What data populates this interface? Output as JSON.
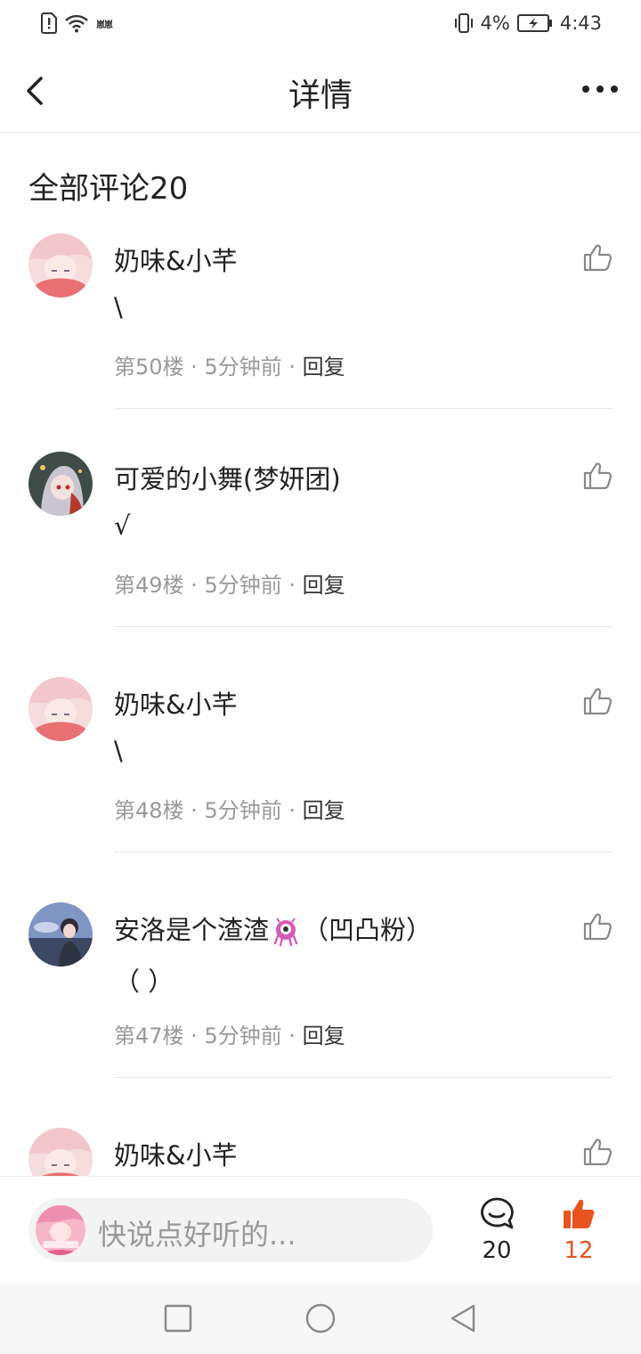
{
  "status_bar": {
    "left_small_text": "崽崽",
    "battery_percent": "4%",
    "time": "4:43",
    "icons": [
      "sim-alert-icon",
      "wifi-icon",
      "vibrate-icon",
      "battery-charging-icon"
    ]
  },
  "header": {
    "title": "详情",
    "back_icon": "back-chevron-icon",
    "more_icon": "more-dots-icon"
  },
  "comments_section": {
    "title": "全部评论20",
    "comments": [
      {
        "name": "奶味&小芊",
        "text": "\\",
        "floor": "第50楼",
        "time": "5分钟前",
        "reply": "回复"
      },
      {
        "name": "可爱的小舞(梦妍团)",
        "text": "√",
        "floor": "第49楼",
        "time": "5分钟前",
        "reply": "回复"
      },
      {
        "name": "奶味&小芊",
        "text": "\\",
        "floor": "第48楼",
        "time": "5分钟前",
        "reply": "回复"
      },
      {
        "name_before": "安洛是个渣渣",
        "name_after": "（凹凸粉）",
        "text": "（ ）",
        "floor": "第47楼",
        "time": "5分钟前",
        "reply": "回复"
      },
      {
        "name": "奶味&小芊"
      }
    ],
    "separator": " · "
  },
  "bottom_bar": {
    "input_placeholder": "快说点好听的...",
    "comment_count": "20",
    "like_count": "12",
    "accent_color": "#e8531e"
  },
  "nav_bar": {
    "icons": [
      "recent-apps-icon",
      "home-icon",
      "back-triangle-icon"
    ]
  }
}
